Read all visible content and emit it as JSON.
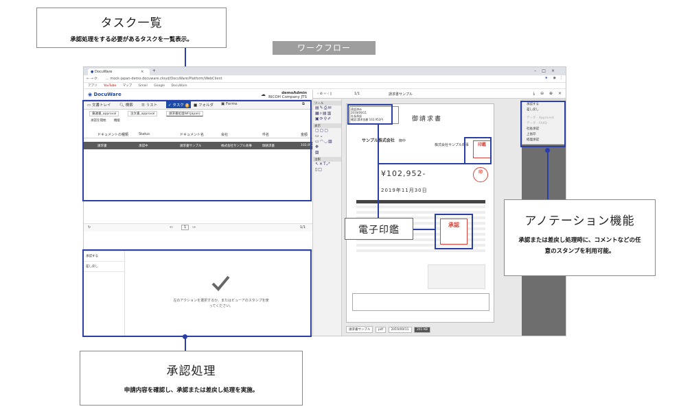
{
  "workflow_label": "ワークフロー",
  "callouts": {
    "tasklist": {
      "title": "タスク一覧",
      "desc": "承認処理をする必要があるタスクを一覧表示。"
    },
    "seal": {
      "title": "電子印鑑"
    },
    "annotation": {
      "title": "アノテーション機能",
      "desc": "承認または差戻し処理時に、コメントなどの任意のスタンプを利用可能。"
    },
    "approval": {
      "title": "承認処理",
      "desc": "申請内容を確認し、承認または差戻し処理を実施。"
    }
  },
  "browser": {
    "tab_title": "DocuWare",
    "url": "... mock-japan-demo.docuware.cloud/DocuWare/Platform/WebClient",
    "bookmarks": [
      "アプリ",
      "YouTube",
      "マップ",
      "Gmail",
      "Google",
      "DocuWare"
    ]
  },
  "app": {
    "logo": "DocuWare",
    "user_name": "demoAdmin",
    "company": "RICOH Company JTS",
    "nav_tabs": [
      "文書トレイ",
      "検索",
      "リスト",
      "タスク",
      "フォルダ",
      "Forms"
    ],
    "task_badge": "2",
    "subtabs": [
      "稟議書_approval",
      "注文書_approval",
      "請求書処理WF(Japan)"
    ],
    "toolbar": [
      "承認を開始",
      "機能"
    ],
    "table_headers": [
      "ドキュメントの種類",
      "Status",
      "ドキュメント名",
      "会社",
      "件名",
      "金額"
    ],
    "table_row": [
      "請求書",
      "承認中",
      "請求書サンプル",
      "株式会社サンプル商事",
      "御請求書",
      "102,952"
    ],
    "pager": "1",
    "pager_count": "1/1",
    "stamp_items": [
      "承認する",
      "差し戻し"
    ],
    "hint": "左のアクションを選択するか、またはビューアのスタンプを使ってください。"
  },
  "viewer": {
    "page_indicator": "1/1",
    "doc_title": "請求書サンプル",
    "side_sections": [
      "ツール",
      "表示",
      "注釈"
    ],
    "stamp_menu": {
      "items": [
        "承認する",
        "差し戻し"
      ],
      "dim_items": [
        "データ - Approved",
        "データ - FAXD"
      ],
      "more_items": [
        "社長承認",
        "上長印",
        "経理承認"
      ]
    },
    "status": [
      "請求書サンプル",
      "pdf",
      "2019/09/11",
      "201 KB"
    ]
  },
  "invoice": {
    "title": "御請求書",
    "recipient": "サンプル株式会社",
    "honorific": "御中",
    "issuer": "株式会社サンプル商事",
    "amount": "¥102,952-",
    "date": "2019年11月30日",
    "stamp_note": [
      "承認済み",
      "2019/09/11",
      "社長承認",
      "確認:請求金額 102,952円"
    ]
  },
  "colors": {
    "accent": "#2a3ea8",
    "seal_red": "#d9443a",
    "dw_blue": "#1e4ba8"
  }
}
